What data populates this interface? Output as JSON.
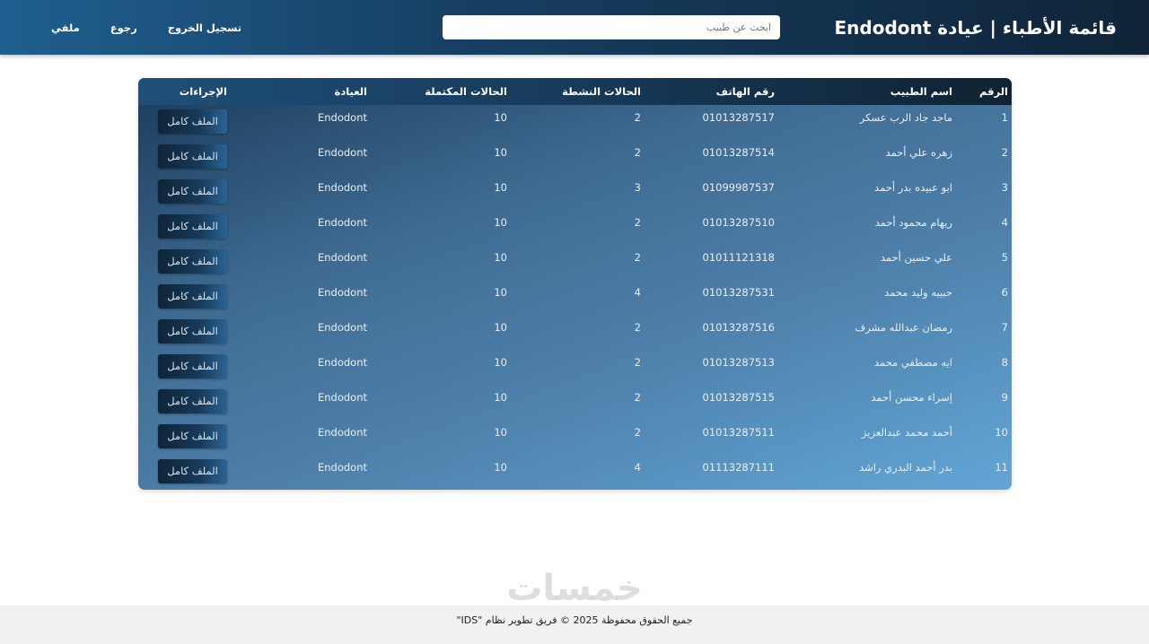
{
  "header": {
    "title": "قائمة الأطباء | عيادة Endodont",
    "search_placeholder": "ابحث عن طبيب",
    "nav": [
      {
        "label": "ملفي"
      },
      {
        "label": "رجوع"
      },
      {
        "label": "تسجيل الخروج"
      }
    ]
  },
  "table": {
    "columns": [
      "الرقم",
      "اسم الطبيب",
      "رقم الهاتف",
      "الحالات النشطة",
      "الحالات المكتملة",
      "العيادة",
      "الإجراءات"
    ],
    "action_label": "الملف كامل",
    "rows": [
      {
        "id": "1",
        "name": "ماجد جاد الرب عسكر",
        "phone": "01013287517",
        "active": "2",
        "completed": "10",
        "clinic": "Endodont"
      },
      {
        "id": "2",
        "name": "زهره علي أحمد",
        "phone": "01013287514",
        "active": "2",
        "completed": "10",
        "clinic": "Endodont"
      },
      {
        "id": "3",
        "name": "ابو عبيده بدر أحمد",
        "phone": "01099987537",
        "active": "3",
        "completed": "10",
        "clinic": "Endodont"
      },
      {
        "id": "4",
        "name": "ريهام محمود أحمد",
        "phone": "01013287510",
        "active": "2",
        "completed": "10",
        "clinic": "Endodont"
      },
      {
        "id": "5",
        "name": "علي حسين أحمد",
        "phone": "01011121318",
        "active": "2",
        "completed": "10",
        "clinic": "Endodont"
      },
      {
        "id": "6",
        "name": "حبيبه وليد محمد",
        "phone": "01013287531",
        "active": "4",
        "completed": "10",
        "clinic": "Endodont"
      },
      {
        "id": "7",
        "name": "رمضان عبدالله مشرف",
        "phone": "01013287516",
        "active": "2",
        "completed": "10",
        "clinic": "Endodont"
      },
      {
        "id": "8",
        "name": "ايه مصطفي محمد",
        "phone": "01013287513",
        "active": "2",
        "completed": "10",
        "clinic": "Endodont"
      },
      {
        "id": "9",
        "name": "إسراء محسن أحمد",
        "phone": "01013287515",
        "active": "2",
        "completed": "10",
        "clinic": "Endodont"
      },
      {
        "id": "10",
        "name": "أحمد محمد عبدالعزيز",
        "phone": "01013287511",
        "active": "2",
        "completed": "10",
        "clinic": "Endodont"
      },
      {
        "id": "11",
        "name": "بدر أحمد البدري راشد",
        "phone": "01113287111",
        "active": "4",
        "completed": "10",
        "clinic": "Endodont"
      }
    ]
  },
  "footer": {
    "text": "جميع الحقوق محفوظة 2025 © فريق تطوير نظام \"IDS\""
  },
  "watermark": {
    "logo_text": "خمسات",
    "url": "nafezly.com"
  }
}
